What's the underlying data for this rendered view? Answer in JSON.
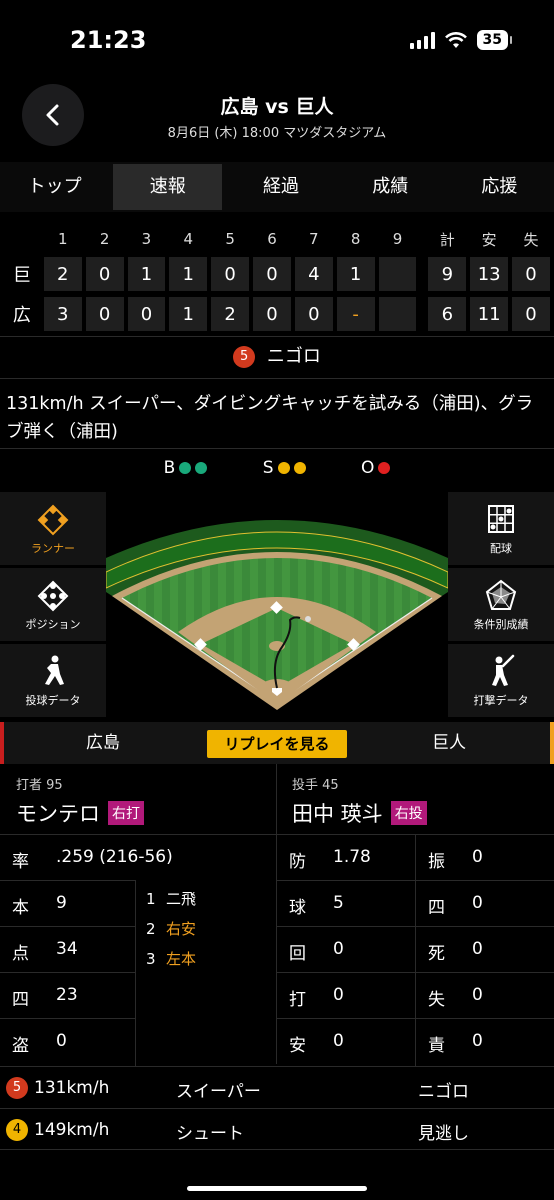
{
  "status": {
    "time": "21:23",
    "battery": "35"
  },
  "header": {
    "title": "広島 vs 巨人",
    "subtitle": "8月6日 (木) 18:00 マツダスタジアム"
  },
  "tabs": [
    "トップ",
    "速報",
    "経過",
    "成績",
    "応援"
  ],
  "active_tab": "速報",
  "scoreboard": {
    "headers": [
      "1",
      "2",
      "3",
      "4",
      "5",
      "6",
      "7",
      "8",
      "9",
      "計",
      "安",
      "失"
    ],
    "rows": [
      {
        "team": "巨",
        "innings": [
          "2",
          "0",
          "1",
          "1",
          "0",
          "0",
          "4",
          "1",
          ""
        ],
        "totals": [
          "9",
          "13",
          "0"
        ]
      },
      {
        "team": "広",
        "innings": [
          "3",
          "0",
          "0",
          "1",
          "2",
          "0",
          "0",
          "-",
          ""
        ],
        "totals": [
          "6",
          "11",
          "0"
        ]
      }
    ]
  },
  "result": {
    "badge": "5",
    "text": "ニゴロ"
  },
  "play_description": "131km/h スイーパー、ダイビングキャッチを試みる（浦田)、グラブ弾く（浦田)",
  "count": {
    "b_label": "B",
    "s_label": "S",
    "o_label": "O",
    "balls": 2,
    "strikes": 2,
    "outs": 1
  },
  "side_buttons": {
    "runner": "ランナー",
    "position": "ポジション",
    "pitching": "投球データ",
    "pitch_loc": "配球",
    "conditional": "条件別成績",
    "batting": "打撃データ"
  },
  "team_bar": {
    "home": "広島",
    "replay": "リプレイを見る",
    "away": "巨人"
  },
  "batter": {
    "role": "打者 95",
    "name": "モンテロ",
    "hand": "右打"
  },
  "pitcher": {
    "role": "投手 45",
    "name": "田中 瑛斗",
    "hand": "右投"
  },
  "batter_stats": [
    {
      "k": "率",
      "v": ".259 (216-56)"
    },
    {
      "k": "本",
      "v": "9"
    },
    {
      "k": "点",
      "v": "34"
    },
    {
      "k": "四",
      "v": "23"
    },
    {
      "k": "盗",
      "v": "0"
    }
  ],
  "at_bats": [
    {
      "n": "1",
      "r": "二飛"
    },
    {
      "n": "2",
      "r": "右安"
    },
    {
      "n": "3",
      "r": "左本"
    }
  ],
  "pitcher_stats_left": [
    {
      "k": "防",
      "v": "1.78"
    },
    {
      "k": "球",
      "v": "5"
    },
    {
      "k": "回",
      "v": "0"
    },
    {
      "k": "打",
      "v": "0"
    },
    {
      "k": "安",
      "v": "0"
    }
  ],
  "pitcher_stats_right": [
    {
      "k": "振",
      "v": "0"
    },
    {
      "k": "四",
      "v": "0"
    },
    {
      "k": "死",
      "v": "0"
    },
    {
      "k": "失",
      "v": "0"
    },
    {
      "k": "責",
      "v": "0"
    }
  ],
  "pitches": [
    {
      "badge": "5",
      "speed": "131km/h",
      "type": "スイーパー",
      "result": "ニゴロ"
    },
    {
      "badge": "4",
      "speed": "149km/h",
      "type": "シュート",
      "result": "見逃し"
    }
  ],
  "colors": {
    "accent": "#f0b400",
    "red": "#d23a1e",
    "ball": "#19a97b",
    "hand_badge": "#b1197a"
  }
}
